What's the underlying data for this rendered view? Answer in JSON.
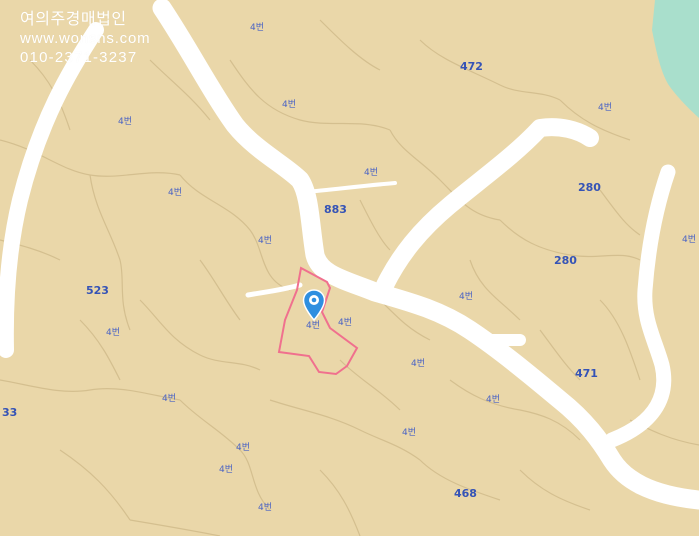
{
  "watermark": {
    "name": "여의주경매법인",
    "website": "www.wonsns.com",
    "phone": "010-2371-3237"
  },
  "colors": {
    "land": "#ead7a9",
    "parcel_line": "#d4bf8f",
    "road": "#ffffff",
    "water": "#a9dfcc",
    "target_outline": "#f0708e",
    "pin": "#2f8fe0",
    "label": "#4a63c4"
  },
  "target_parcel": {
    "label": "4번",
    "pin_icon": "map-pin-icon"
  },
  "parcel_labels": [
    {
      "id": "l1",
      "text": "472",
      "big": true
    },
    {
      "id": "l2",
      "text": "280",
      "big": true
    },
    {
      "id": "l3",
      "text": "280",
      "big": true
    },
    {
      "id": "l4",
      "text": "471",
      "big": true
    },
    {
      "id": "l5",
      "text": "468",
      "big": true
    },
    {
      "id": "l6",
      "text": "883",
      "big": true
    },
    {
      "id": "l7",
      "text": "523",
      "big": true
    },
    {
      "id": "l8",
      "text": "33",
      "big": true
    },
    {
      "id": "l9",
      "text": "4번",
      "big": false
    },
    {
      "id": "l10",
      "text": "4번",
      "big": false
    },
    {
      "id": "l11",
      "text": "4번",
      "big": false
    },
    {
      "id": "l12",
      "text": "4번",
      "big": false
    },
    {
      "id": "l13",
      "text": "4번",
      "big": false
    },
    {
      "id": "l14",
      "text": "4번",
      "big": false
    },
    {
      "id": "l15",
      "text": "4번",
      "big": false
    },
    {
      "id": "l16",
      "text": "4번",
      "big": false
    },
    {
      "id": "l17",
      "text": "4번",
      "big": false
    },
    {
      "id": "l18",
      "text": "4번",
      "big": false
    },
    {
      "id": "l19",
      "text": "4번",
      "big": false
    },
    {
      "id": "l20",
      "text": "4번",
      "big": false
    },
    {
      "id": "l21",
      "text": "4번",
      "big": false
    },
    {
      "id": "l22",
      "text": "4번",
      "big": false
    },
    {
      "id": "l23",
      "text": "4번",
      "big": false
    },
    {
      "id": "l24",
      "text": "4번",
      "big": false
    },
    {
      "id": "l25",
      "text": "4번",
      "big": false
    },
    {
      "id": "l26",
      "text": "4번",
      "big": false
    }
  ]
}
